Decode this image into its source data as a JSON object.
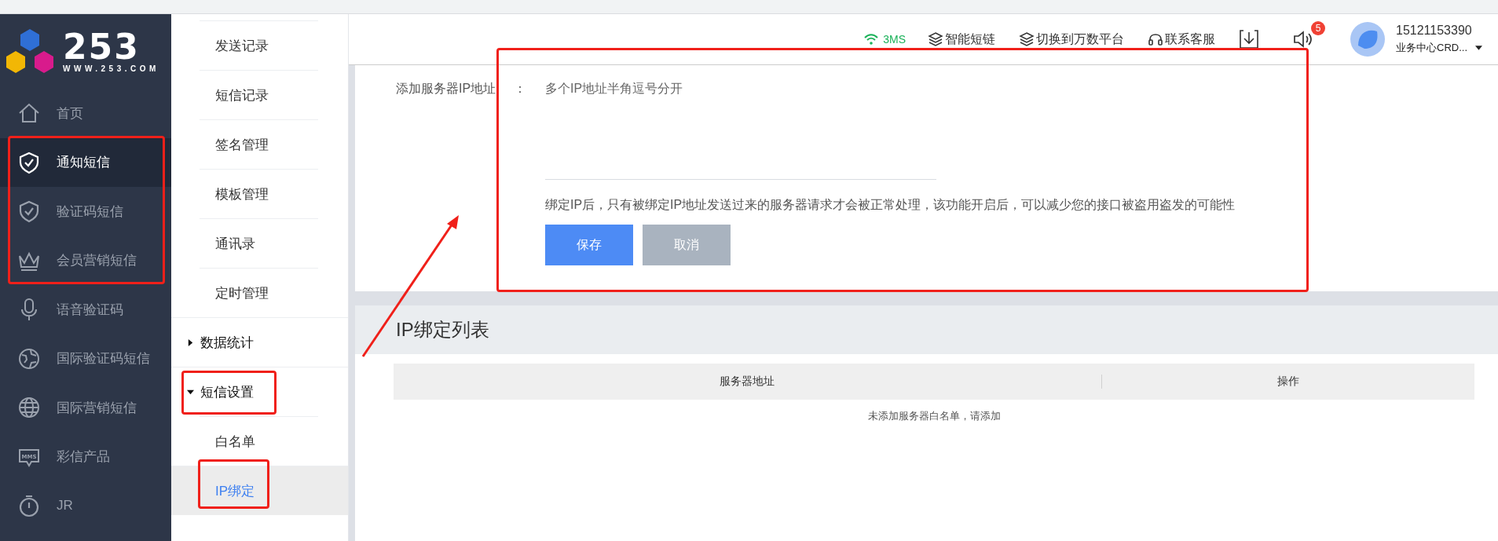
{
  "logo": {
    "name": "253",
    "url": "WWW.253.COM"
  },
  "sidebar": {
    "items": [
      {
        "label": "首页",
        "kind": "home",
        "selected": false
      },
      {
        "label": "通知短信",
        "kind": "shield",
        "selected": true
      },
      {
        "label": "验证码短信",
        "kind": "shield",
        "selected": false
      },
      {
        "label": "会员营销短信",
        "kind": "crown",
        "selected": false
      },
      {
        "label": "语音验证码",
        "kind": "mic",
        "selected": false
      },
      {
        "label": "国际验证码短信",
        "kind": "earth",
        "selected": false
      },
      {
        "label": "国际营销短信",
        "kind": "globe",
        "selected": false
      },
      {
        "label": "彩信产品",
        "kind": "mms",
        "icon_label": "MMS",
        "selected": false
      },
      {
        "label": "JR",
        "kind": "timer",
        "selected": false
      }
    ]
  },
  "submenu": {
    "items": [
      {
        "kind": "item",
        "label": "发送记录",
        "selected": false
      },
      {
        "kind": "item",
        "label": "短信记录",
        "selected": false
      },
      {
        "kind": "item",
        "label": "签名管理",
        "selected": false
      },
      {
        "kind": "item",
        "label": "模板管理",
        "selected": false
      },
      {
        "kind": "item",
        "label": "通讯录",
        "selected": false
      },
      {
        "kind": "item",
        "label": "定时管理",
        "selected": false
      },
      {
        "kind": "group",
        "label": "数据统计",
        "expanded": false
      },
      {
        "kind": "group",
        "label": "短信设置",
        "expanded": true,
        "children": [
          {
            "label": "白名单",
            "selected": false
          },
          {
            "label": "IP绑定",
            "selected": true
          }
        ]
      }
    ]
  },
  "header": {
    "signal": "3MS",
    "links": [
      {
        "label": "智能短链",
        "kind": "layers"
      },
      {
        "label": "切换到万数平台",
        "kind": "layers"
      },
      {
        "label": "联系客服",
        "kind": "headset"
      }
    ],
    "notifications": "5",
    "user": {
      "phone": "15121153390",
      "org": "业务中心CRD..."
    }
  },
  "form": {
    "label": "添加服务器IP地址",
    "colon": "：",
    "placeholder": "多个IP地址半角逗号分开",
    "hint": "绑定IP后，只有被绑定IP地址发送过来的服务器请求才会被正常处理，该功能开启后，可以减少您的接口被盗用盗发的可能性",
    "buttons": [
      {
        "label": "保存",
        "kind": "primary"
      },
      {
        "label": "取消",
        "kind": "secondary"
      }
    ]
  },
  "list": {
    "title": "IP绑定列表",
    "columns": [
      "服务器地址",
      "操作"
    ],
    "empty": "未添加服务器白名单，请添加"
  }
}
